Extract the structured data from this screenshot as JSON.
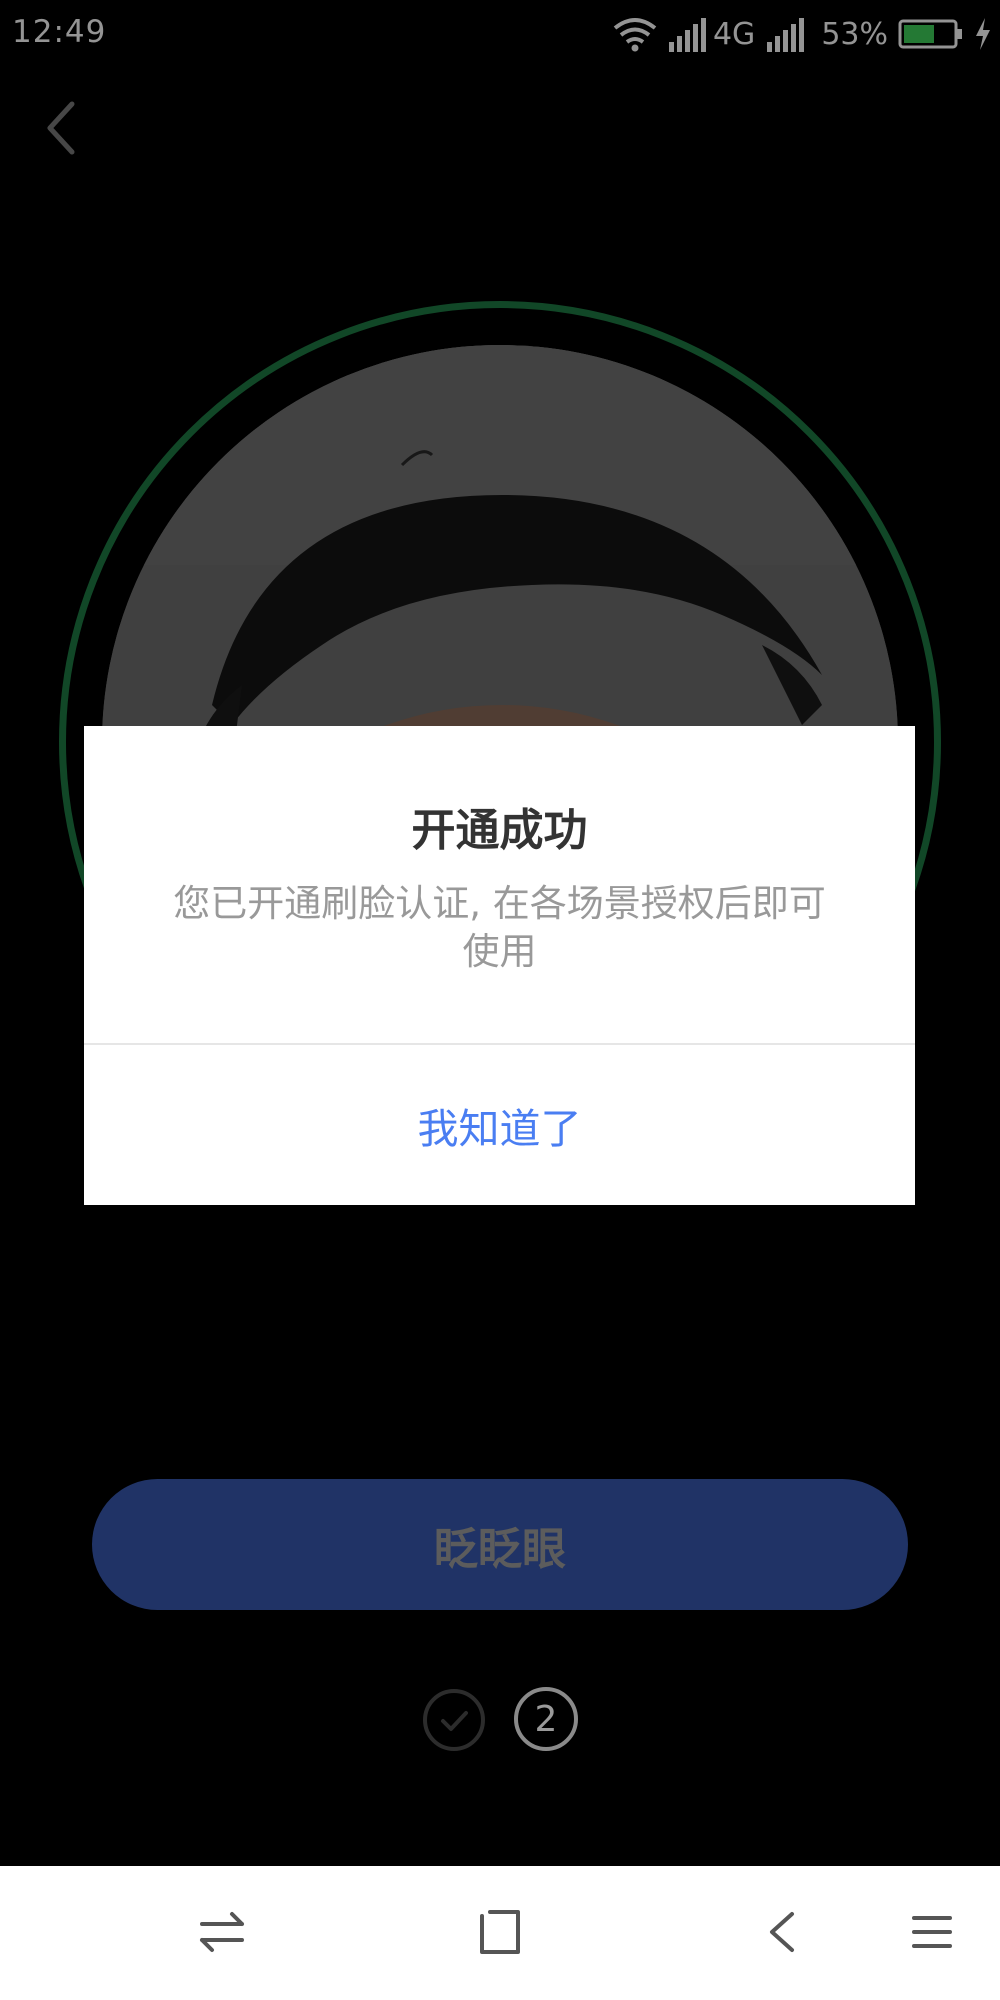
{
  "status_bar": {
    "time": "12:49",
    "network": "4G",
    "battery_percent": "53%",
    "icons": [
      "wifi-icon",
      "signal-icon",
      "signal-icon",
      "battery-icon",
      "charging-icon"
    ]
  },
  "header": {
    "back_icon": "chevron-left-icon"
  },
  "dialog": {
    "title": "开通成功",
    "message": "您已开通刷脸认证, 在各场景授权后即可使用",
    "button_label": "我知道了",
    "button_color": "#4a7ef2"
  },
  "main": {
    "blink_button_label": "眨眨眼",
    "ring_color": "#1e7a44",
    "steps": [
      {
        "state": "done",
        "icon": "check-icon"
      },
      {
        "state": "current",
        "label": "2"
      }
    ]
  },
  "nav_bar": {
    "icons": [
      "switch-apps-icon",
      "home-square-icon",
      "back-arrow-icon",
      "menu-icon"
    ]
  }
}
